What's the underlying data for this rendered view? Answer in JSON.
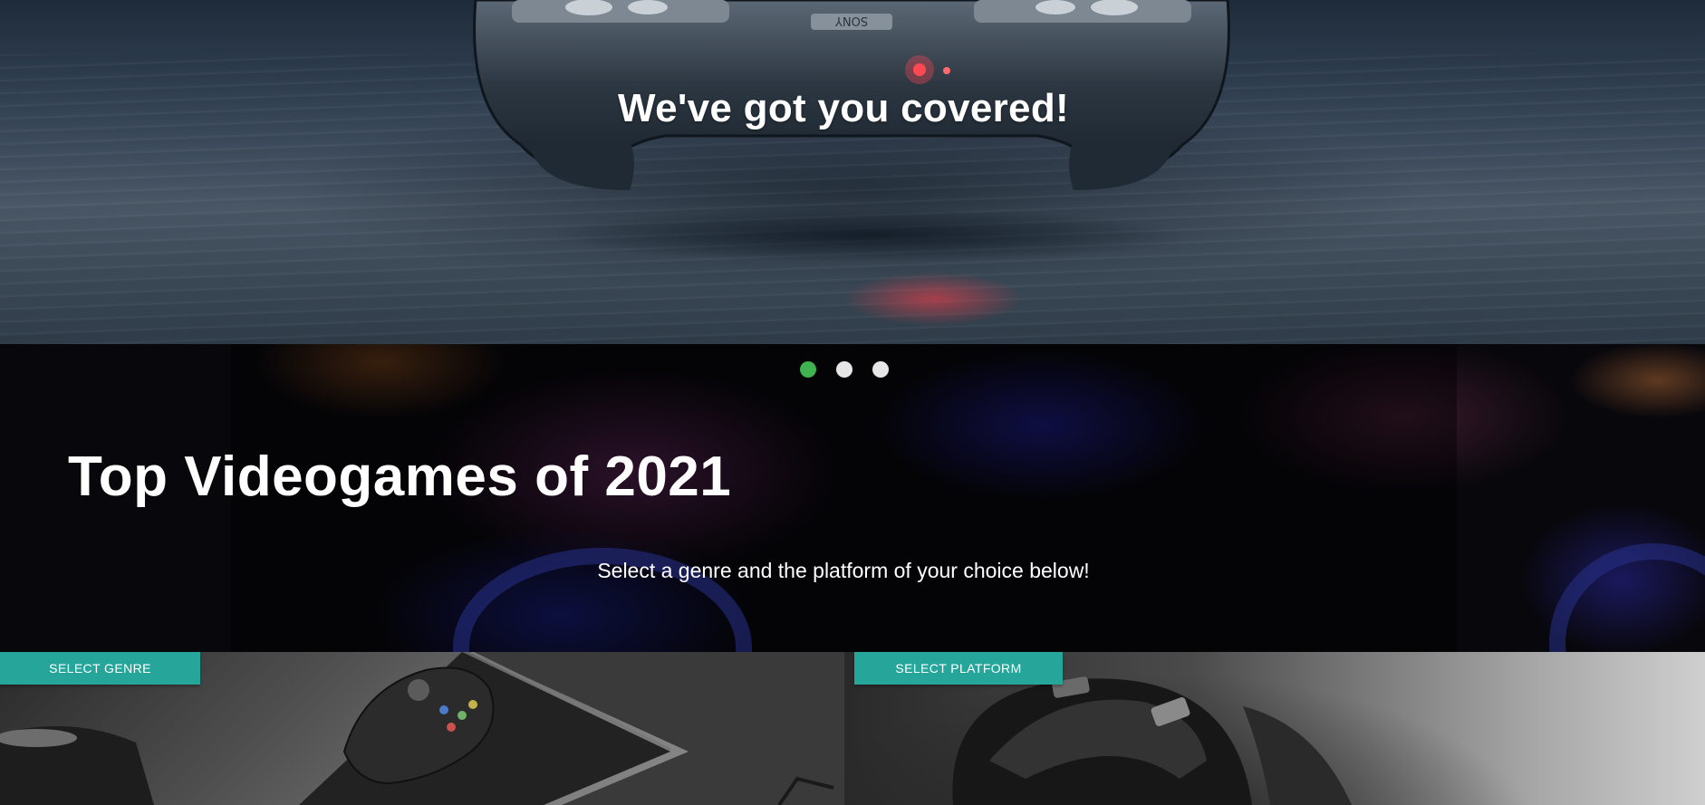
{
  "hero": {
    "title": "We've got you covered!",
    "controller_brand": "SONY"
  },
  "carousel": {
    "slide_count": 3,
    "active_index": 0,
    "active_color": "#3fb34f",
    "inactive_color": "#e6e6e6"
  },
  "promo": {
    "heading": "Top Videogames of 2021",
    "subtitle": "Select a genre and the platform of your choice below!"
  },
  "genre_panel": {
    "button_label": "SELECT GENRE",
    "accent": "#26a69a"
  },
  "platform_panel": {
    "button_label": "SELECT PLATFORM",
    "accent": "#26a69a"
  }
}
